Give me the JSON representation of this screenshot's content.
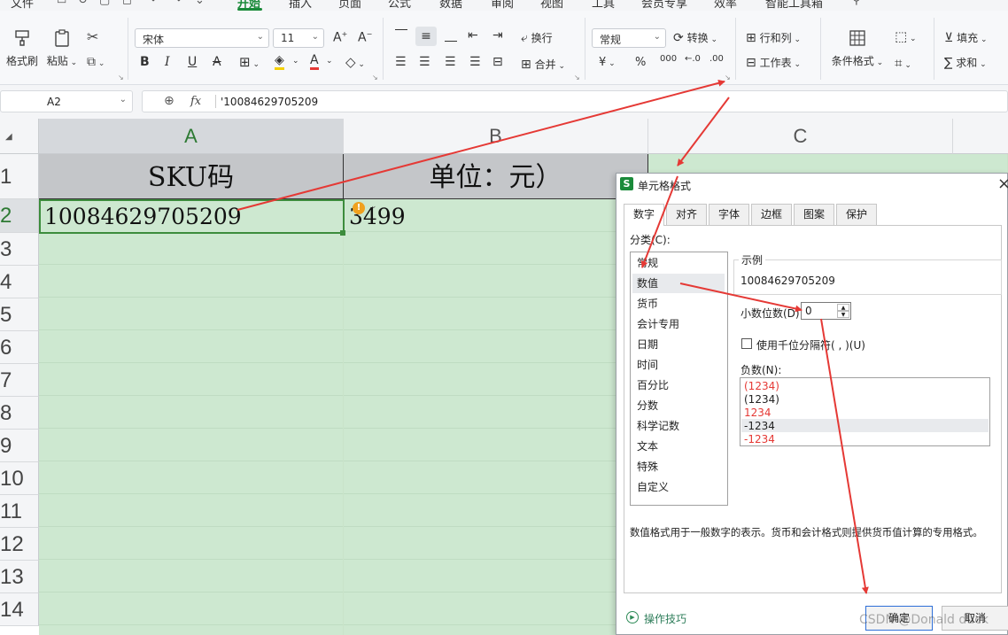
{
  "menus": [
    {
      "label": "文件",
      "active": false
    },
    {
      "label": "开始",
      "active": true
    },
    {
      "label": "插入",
      "active": false
    },
    {
      "label": "页面",
      "active": false
    },
    {
      "label": "公式",
      "active": false
    },
    {
      "label": "数据",
      "active": false
    },
    {
      "label": "审阅",
      "active": false
    },
    {
      "label": "视图",
      "active": false
    },
    {
      "label": "工具",
      "active": false
    },
    {
      "label": "会员专享",
      "active": false
    },
    {
      "label": "效率",
      "active": false
    },
    {
      "label": "智能工具箱",
      "active": false
    }
  ],
  "ribbon": {
    "format_painter": "格式刷",
    "paste": "粘贴",
    "font_name": "宋体",
    "font_size": "11",
    "bold": "B",
    "italic": "I",
    "underline": "U",
    "strike": "A",
    "wrap": "换行",
    "merge": "合并",
    "number_format": "常规",
    "convert": "转换",
    "currency": "¥",
    "percent": "%",
    "thousands": "000",
    "dec_inc": "←.0",
    "dec_dec": ".00",
    "rows_cols": "行和列",
    "worksheet": "工作表",
    "cond_format": "条件格式",
    "fill": "填充",
    "sum": "求和"
  },
  "formula_bar": {
    "name_box": "A2",
    "fx": "fx",
    "content": "'10084629705209"
  },
  "grid": {
    "columns": [
      "A",
      "B",
      "C"
    ],
    "rows": [
      "1",
      "2",
      "3",
      "4",
      "5",
      "6",
      "7",
      "8",
      "9",
      "10",
      "11",
      "12",
      "13",
      "14"
    ],
    "header_a": "SKU码",
    "header_b": "单位：元）",
    "a2": "10084629705209",
    "b2": "3499",
    "error_badge": "!"
  },
  "dialog": {
    "icon_letter": "S",
    "title": "单元格格式",
    "close": "×",
    "tabs": [
      "数字",
      "对齐",
      "字体",
      "边框",
      "图案",
      "保护"
    ],
    "active_tab": "数字",
    "category_label": "分类(C):",
    "categories": [
      "常规",
      "数值",
      "货币",
      "会计专用",
      "日期",
      "时间",
      "百分比",
      "分数",
      "科学记数",
      "文本",
      "特殊",
      "自定义"
    ],
    "selected_category": "数值",
    "sample_label": "示例",
    "sample_value": "10084629705209",
    "decimal_label": "小数位数(D):",
    "decimal_value": "0",
    "thousands_label": "使用千位分隔符( , )(U)",
    "negative_label": "负数(N):",
    "negatives": [
      {
        "text": "(1234)",
        "color": "#e53935"
      },
      {
        "text": "(1234)",
        "color": "#222222"
      },
      {
        "text": "1234",
        "color": "#e53935"
      },
      {
        "text": "-1234",
        "color": "#222222"
      },
      {
        "text": "-1234",
        "color": "#e53935"
      }
    ],
    "description": "数值格式用于一般数字的表示。货币和会计格式则提供货币值计算的专用格式。",
    "tips": "操作技巧",
    "ok": "确定",
    "cancel": "取消"
  },
  "watermark": "CSDN @Donald duck",
  "colors": {
    "accent_green": "#1a8a3a",
    "cell_fill": "#cde8d0",
    "header_fill": "#d5d8dc",
    "arrow_red": "#e53935"
  }
}
